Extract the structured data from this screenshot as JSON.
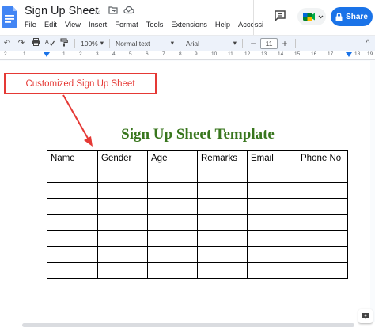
{
  "app": {
    "doc_title": "Sign Up Sheet",
    "share_label": "Share"
  },
  "menu": [
    "File",
    "Edit",
    "View",
    "Insert",
    "Format",
    "Tools",
    "Extensions",
    "Help",
    "Accessi"
  ],
  "toolbar": {
    "zoom": "100%",
    "style": "Normal text",
    "font": "Arial",
    "font_size": "11"
  },
  "ruler": {
    "numbers": [
      "2",
      "1",
      "1",
      "2",
      "3",
      "4",
      "5",
      "6",
      "7",
      "8",
      "9",
      "10",
      "11",
      "12",
      "13",
      "14",
      "15",
      "16",
      "17",
      "18",
      "19"
    ]
  },
  "document": {
    "callout": "Customized Sign Up Sheet",
    "heading": "Sign Up Sheet Template",
    "table": {
      "headers": [
        "Name",
        "Gender",
        "Age",
        "Remarks",
        "Email",
        "Phone No"
      ],
      "empty_rows": 7
    }
  },
  "colors": {
    "share_button": "#1a73e8",
    "heading": "#38761d",
    "callout": "#e53935",
    "docs_blue": "#4285f4"
  }
}
